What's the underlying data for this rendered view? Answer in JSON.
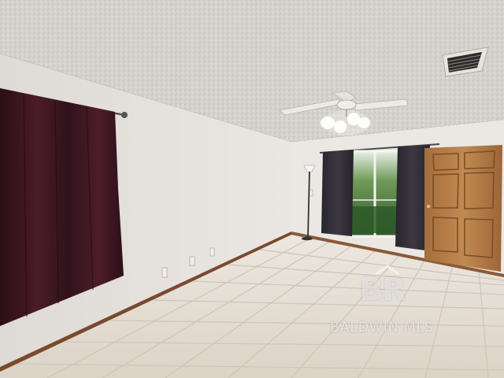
{
  "photo": {
    "subject": "empty-room-interior"
  },
  "watermark": {
    "logo_text": "BR",
    "label": "BALDWIN MLS"
  },
  "colors": {
    "ceiling": "#d9d6d1",
    "wall_left": "#e6e3df",
    "wall_back": "#ece9e5",
    "floor_tile": "#e2dbd0",
    "grout": "#c8c0b4",
    "baseboard": "#7a4a2e",
    "curtain_left": "#3a1520",
    "curtain_back": "#2f2d36",
    "door": "#b27a45",
    "window_foliage": "#3f6a34"
  }
}
